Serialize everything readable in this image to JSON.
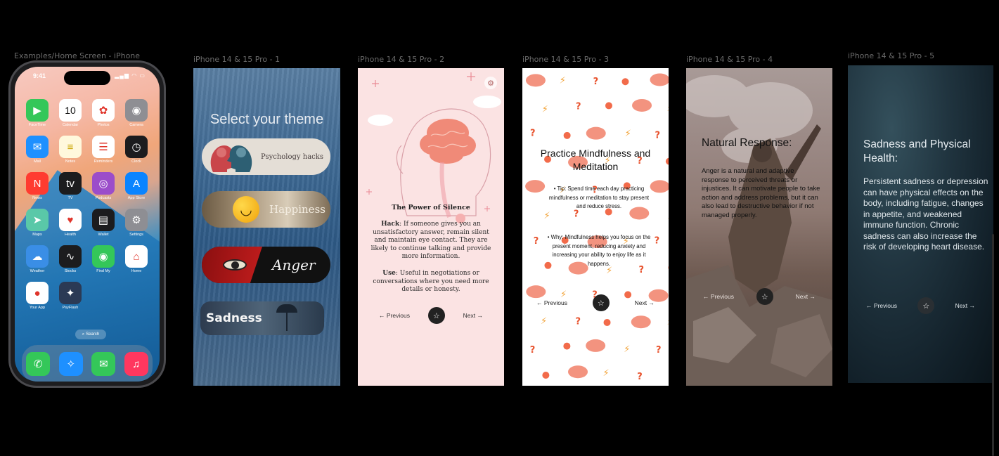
{
  "frame_labels": {
    "home": "Examples/Home Screen - iPhone",
    "f1": "iPhone 14 & 15 Pro - 1",
    "f2": "iPhone 14 & 15 Pro - 2",
    "f3": "iPhone 14 & 15 Pro - 3",
    "f4": "iPhone 14 & 15 Pro - 4",
    "f5": "iPhone 14 & 15 Pro - 5"
  },
  "home_screen": {
    "time": "9:41",
    "status_icons": "▂▄▆ ◠ ▭",
    "apps": [
      {
        "label": "FaceTime",
        "icon": "video-icon",
        "glyph": "▶",
        "color": "#34c759"
      },
      {
        "label": "Calendar",
        "icon": "calendar-icon",
        "glyph": "10",
        "color": "#ffffff"
      },
      {
        "label": "Photos",
        "icon": "photos-icon",
        "glyph": "✿",
        "color": "#ffffff"
      },
      {
        "label": "Camera",
        "icon": "camera-icon",
        "glyph": "◉",
        "color": "#8e8e93"
      },
      {
        "label": "Mail",
        "icon": "mail-icon",
        "glyph": "✉",
        "color": "#1e90ff"
      },
      {
        "label": "Notes",
        "icon": "notes-icon",
        "glyph": "≡",
        "color": "#fff8dc"
      },
      {
        "label": "Reminders",
        "icon": "reminders-icon",
        "glyph": "☰",
        "color": "#ffffff"
      },
      {
        "label": "Clock",
        "icon": "clock-icon",
        "glyph": "◷",
        "color": "#1c1c1e"
      },
      {
        "label": "News",
        "icon": "news-icon",
        "glyph": "N",
        "color": "#ff3b30"
      },
      {
        "label": "TV",
        "icon": "tv-icon",
        "glyph": "tv",
        "color": "#1c1c1e"
      },
      {
        "label": "Podcasts",
        "icon": "podcasts-icon",
        "glyph": "◎",
        "color": "#9b4dca"
      },
      {
        "label": "App Store",
        "icon": "app-store-icon",
        "glyph": "A",
        "color": "#0a84ff"
      },
      {
        "label": "Maps",
        "icon": "maps-icon",
        "glyph": "➤",
        "color": "#5ac8a8"
      },
      {
        "label": "Health",
        "icon": "health-icon",
        "glyph": "♥",
        "color": "#ffffff"
      },
      {
        "label": "Wallet",
        "icon": "wallet-icon",
        "glyph": "▤",
        "color": "#1c1c1e"
      },
      {
        "label": "Settings",
        "icon": "settings-icon",
        "glyph": "⚙",
        "color": "#8e8e93"
      },
      {
        "label": "Weather",
        "icon": "weather-icon",
        "glyph": "☁",
        "color": "#3a8ee6"
      },
      {
        "label": "Stocks",
        "icon": "stocks-icon",
        "glyph": "∿",
        "color": "#1c1c1e"
      },
      {
        "label": "Find My",
        "icon": "find-my-icon",
        "glyph": "◉",
        "color": "#34c759"
      },
      {
        "label": "Home",
        "icon": "home-icon",
        "glyph": "⌂",
        "color": "#ffffff"
      },
      {
        "label": "Your App",
        "icon": "your-app-icon",
        "glyph": "●",
        "color": "#ffffff"
      },
      {
        "label": "PsyFlash",
        "icon": "psyflash-icon",
        "glyph": "✦",
        "color": "#2b3a55"
      }
    ],
    "search_label": "Search",
    "dock": [
      {
        "icon": "phone-icon",
        "glyph": "✆",
        "color": "#34c759"
      },
      {
        "icon": "safari-icon",
        "glyph": "✧",
        "color": "#1e90ff"
      },
      {
        "icon": "messages-icon",
        "glyph": "✉",
        "color": "#34c759"
      },
      {
        "icon": "music-icon",
        "glyph": "♫",
        "color": "#ff375f"
      }
    ]
  },
  "frame1": {
    "title": "Select your theme",
    "themes": [
      "Psychology hacks",
      "Happiness",
      "Anger",
      "Sadness"
    ]
  },
  "frame2": {
    "heading": "The Power of Silence",
    "hack_label": "Hack",
    "hack_text": ": If someone gives you an unsatisfactory answer, remain silent and maintain eye contact. They are likely to continue talking and provide more information.",
    "use_label": "Use",
    "use_text": ": Useful in negotiations or conversations where you need more details or honesty.",
    "prev": "Previous",
    "next": "Next"
  },
  "frame3": {
    "heading": "Practice Mindfulness and Meditation",
    "tip": "Tip: Spend time each day practicing mindfulness or meditation to stay present and reduce stress.",
    "why": "Why: Mindfulness helps you focus on the present moment, reducing anxiety and increasing your ability to enjoy life as it happens.",
    "prev": "Previous",
    "next": "Next"
  },
  "frame4": {
    "heading": "Natural Response:",
    "body": "Anger is a natural and adaptive response to perceived threats or injustices. It can motivate people to take action and address problems, but it can also lead to destructive behavior if not managed properly.",
    "prev": "Previous",
    "next": "Next"
  },
  "frame5": {
    "heading": "Sadness and Physical Health:",
    "body": "Persistent sadness or depression can have physical effects on the body, including fatigue, changes in appetite, and weakened immune function. Chronic sadness can also increase the risk of developing heart disease.",
    "prev": "Previous",
    "next": "Next"
  },
  "colors": {
    "canvas_bg": "#000000",
    "label_gray": "#6b6b6b",
    "pink_bg": "#fbe3e3",
    "brain_coral": "#f08a78"
  }
}
